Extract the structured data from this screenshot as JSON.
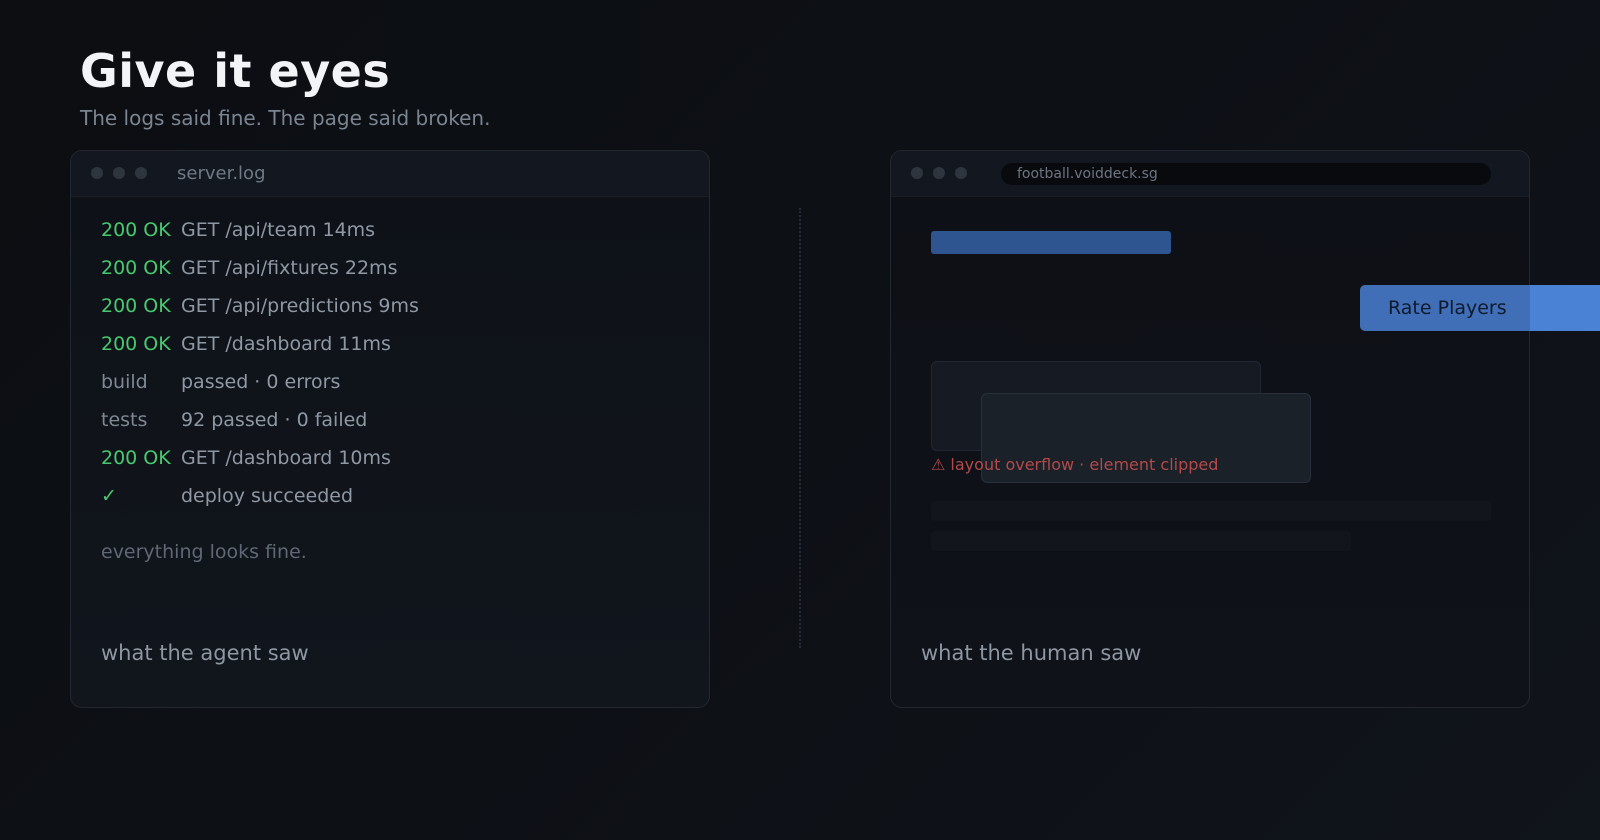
{
  "header": {
    "title": "Give it eyes",
    "subtitle": "The logs said fine. The page said broken."
  },
  "left_panel": {
    "window_title": "server.log",
    "log": [
      {
        "status": "200 OK",
        "message": "GET /api/team 14ms",
        "kind": "ok"
      },
      {
        "status": "200 OK",
        "message": "GET /api/fixtures 22ms",
        "kind": "ok"
      },
      {
        "status": "200 OK",
        "message": "GET /api/predictions 9ms",
        "kind": "ok"
      },
      {
        "status": "200 OK",
        "message": "GET /dashboard 11ms",
        "kind": "ok"
      },
      {
        "status": "build",
        "message": "passed · 0 errors",
        "kind": "neutral"
      },
      {
        "status": "tests",
        "message": "92 passed · 0 failed",
        "kind": "neutral"
      },
      {
        "status": "200 OK",
        "message": "GET /dashboard 10ms",
        "kind": "ok"
      },
      {
        "status": "✓",
        "message": "deploy succeeded",
        "kind": "ok"
      }
    ],
    "footer": "everything looks fine.",
    "caption": "what the agent saw"
  },
  "right_panel": {
    "url": "football.voiddeck.sg",
    "warning": "⚠ layout overflow · element clipped",
    "button_label": "Rate Players",
    "caption": "what the human saw"
  },
  "colors": {
    "ok": "#49c96f",
    "accent": "#4a82d6",
    "warning": "#b34a4a",
    "background": "#0d1015"
  }
}
